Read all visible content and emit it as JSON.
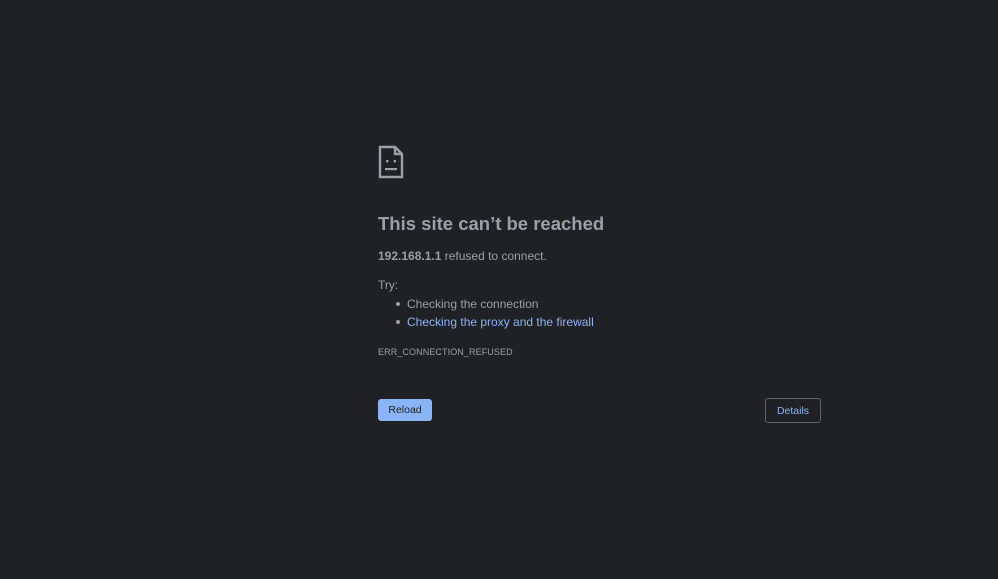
{
  "error_page": {
    "title": "This site can’t be reached",
    "host": "192.168.1.1",
    "summary_suffix": " refused to connect.",
    "try_label": "Try:",
    "suggestions": [
      {
        "text": "Checking the connection",
        "is_link": false
      },
      {
        "text": "Checking the proxy and the firewall",
        "is_link": true
      }
    ],
    "error_code": "ERR_CONNECTION_REFUSED",
    "reload_label": "Reload",
    "details_label": "Details",
    "icon": "sad-document-icon"
  },
  "colors": {
    "background": "#202124",
    "text": "#9aa0a6",
    "accent": "#8ab4f8",
    "border": "#5f6368"
  }
}
